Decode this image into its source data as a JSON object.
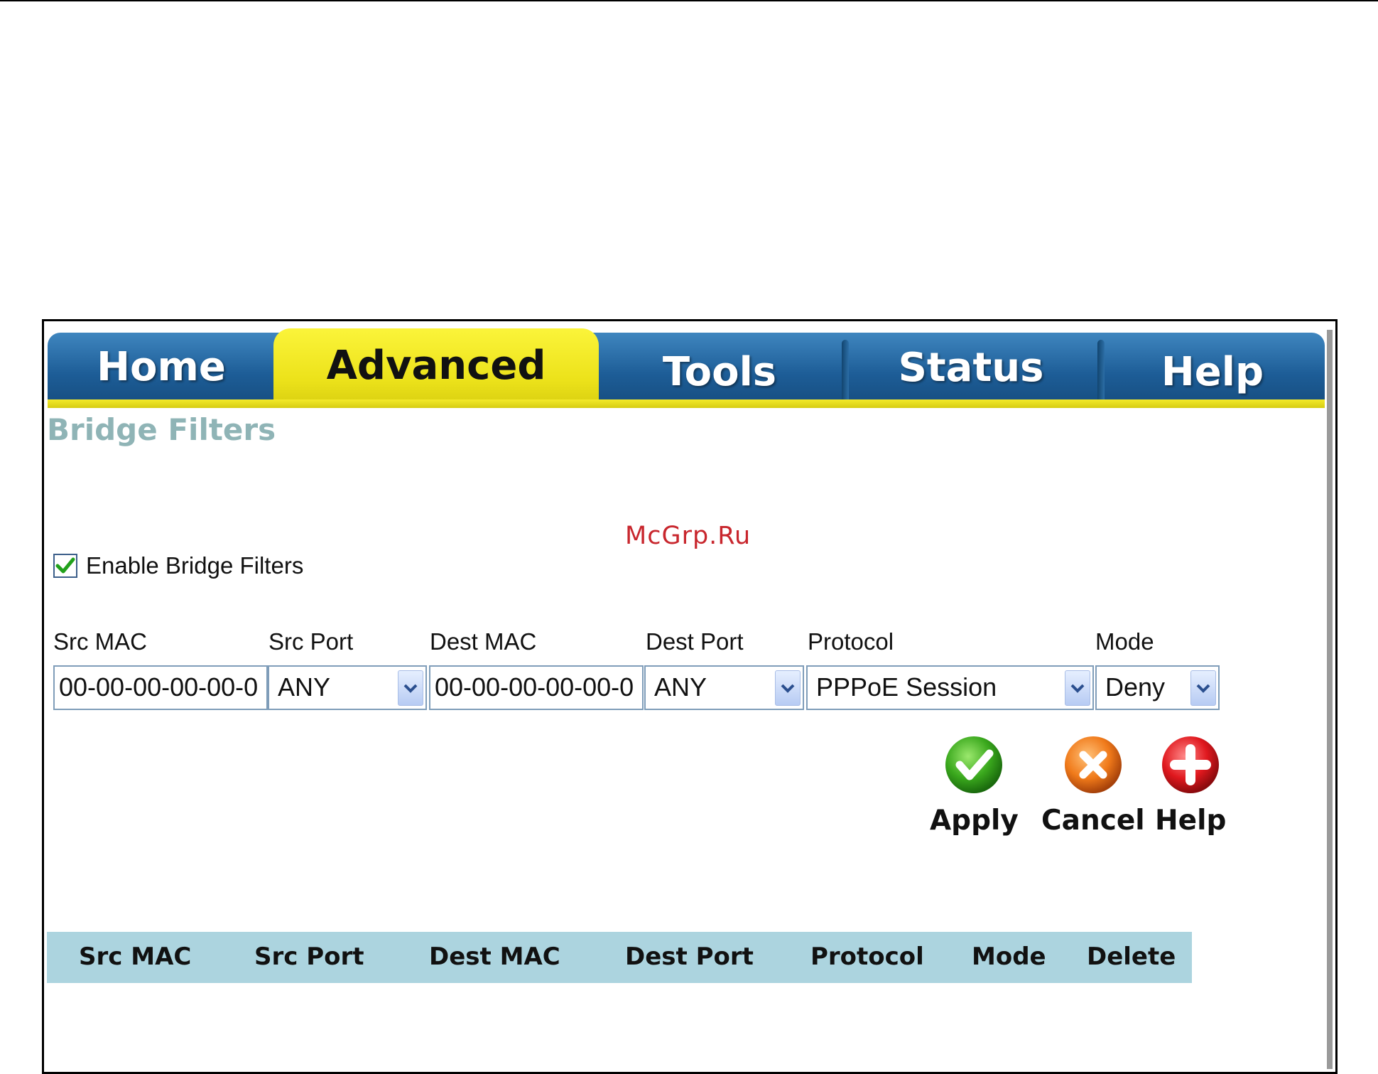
{
  "nav": {
    "tabs": [
      {
        "label": "Home",
        "active": false
      },
      {
        "label": "Advanced",
        "active": true
      },
      {
        "label": "Tools",
        "active": false
      },
      {
        "label": "Status",
        "active": false
      },
      {
        "label": "Help",
        "active": false
      }
    ]
  },
  "page": {
    "title": "Bridge Filters",
    "watermark": "McGrp.Ru"
  },
  "enable": {
    "label": "Enable Bridge Filters",
    "checked": true
  },
  "form": {
    "labels": {
      "src_mac": "Src MAC",
      "src_port": "Src Port",
      "dest_mac": "Dest MAC",
      "dest_port": "Dest Port",
      "protocol": "Protocol",
      "mode": "Mode"
    },
    "values": {
      "src_mac": "00-00-00-00-00-0",
      "src_port": "ANY",
      "dest_mac": "00-00-00-00-00-0",
      "dest_port": "ANY",
      "protocol": "PPPoE Session",
      "mode": "Deny"
    }
  },
  "actions": {
    "apply": "Apply",
    "cancel": "Cancel",
    "help": "Help"
  },
  "table": {
    "columns": [
      "Src MAC",
      "Src Port",
      "Dest MAC",
      "Dest Port",
      "Protocol",
      "Mode",
      "Delete"
    ]
  },
  "colors": {
    "tab_blue": "#1d5d97",
    "tab_active_yellow": "#ece21a",
    "title_color": "#8fb4b6",
    "table_header_bg": "#acd4df",
    "watermark_red": "#c8262d"
  }
}
